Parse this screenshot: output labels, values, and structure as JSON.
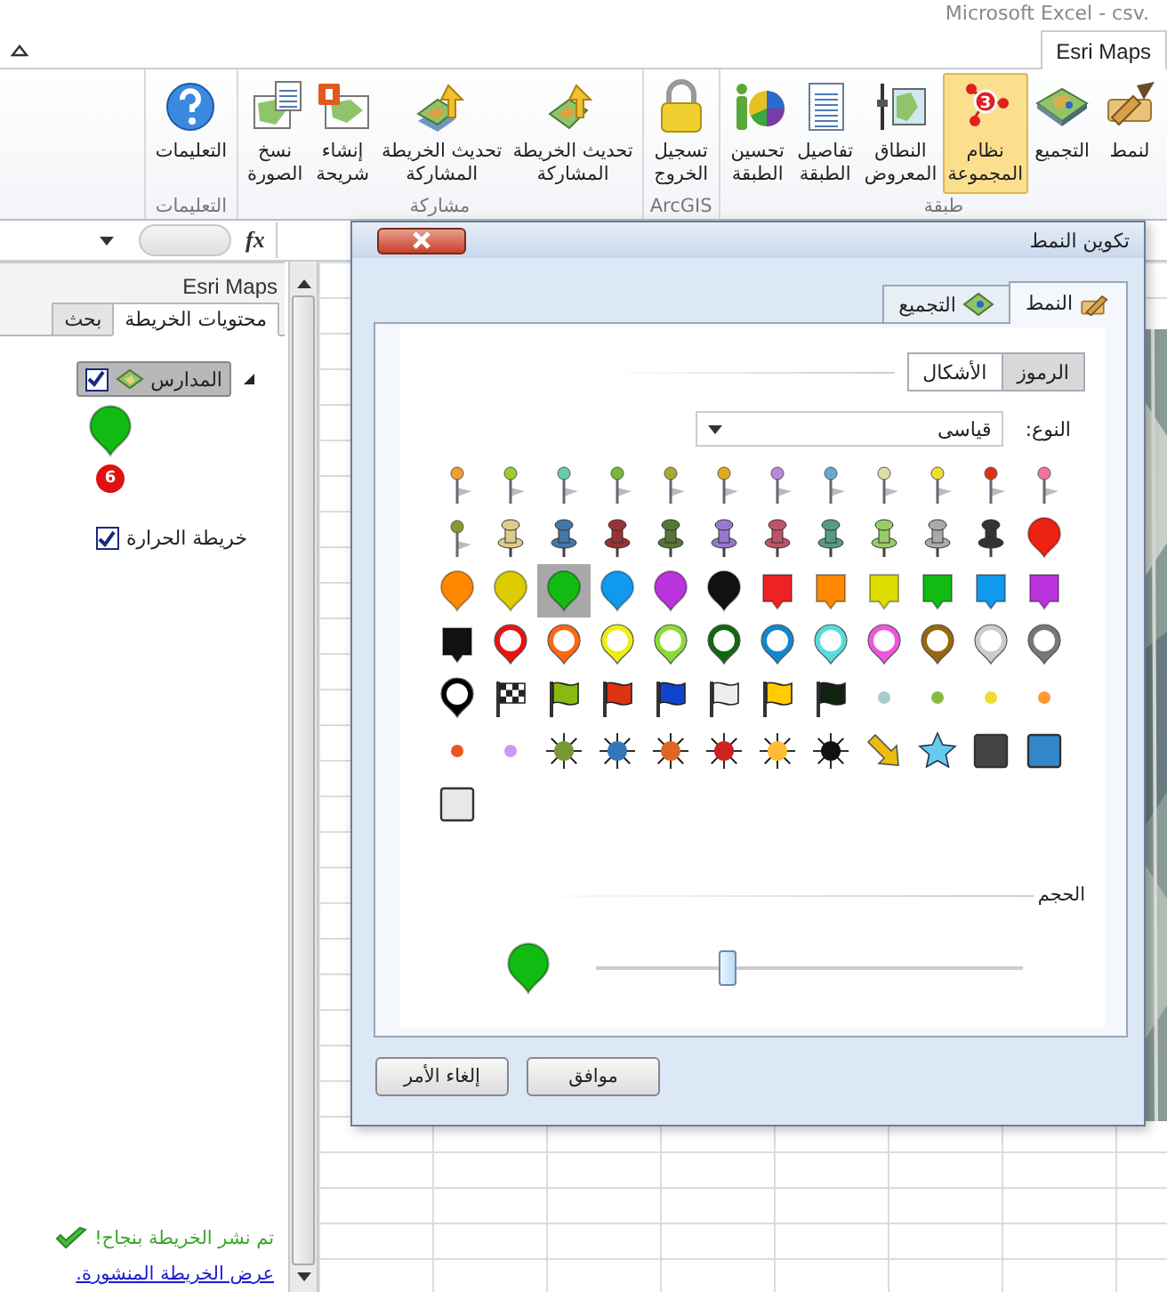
{
  "window": {
    "title": "Microsoft Excel - csv."
  },
  "ribbon_tabs": [
    {
      "label": "Esri Maps",
      "selected": true
    }
  ],
  "ribbon": {
    "groups": [
      {
        "label": "طبقة",
        "buttons": [
          {
            "lines": [
              "لنمط"
            ],
            "kind": "brush",
            "selected": false
          },
          {
            "lines": [
              "التجميع"
            ],
            "kind": "map",
            "selected": false
          },
          {
            "lines": [
              "نظام",
              "المجموعة"
            ],
            "kind": "cluster",
            "badge": "3",
            "selected": true
          },
          {
            "lines": [
              "النطاق",
              "المعروض"
            ],
            "kind": "extent",
            "selected": false
          },
          {
            "lines": [
              "تفاصيل",
              "الطبقة"
            ],
            "kind": "details",
            "selected": false
          },
          {
            "lines": [
              "تحسين",
              "الطبقة"
            ],
            "kind": "enhance",
            "selected": false
          }
        ]
      },
      {
        "label": "ArcGIS",
        "buttons": [
          {
            "lines": [
              "تسجيل",
              "الخروج"
            ],
            "kind": "signout",
            "selected": false
          }
        ]
      },
      {
        "label": "مشاركة",
        "buttons": [
          {
            "lines": [
              "تحديث الخريطة",
              "المشاركة"
            ],
            "kind": "share",
            "selected": false
          },
          {
            "lines": [
              "تحديث الخريطة",
              "المشاركة"
            ],
            "kind": "share-stack",
            "selected": false
          },
          {
            "lines": [
              "إنشاء",
              "شريحة"
            ],
            "kind": "slide",
            "selected": false
          },
          {
            "lines": [
              "نسخ",
              "الصورة"
            ],
            "kind": "copy",
            "selected": false
          }
        ]
      },
      {
        "label": "التعليمات",
        "buttons": [
          {
            "lines": [
              "التعليمات"
            ],
            "kind": "help",
            "selected": false
          }
        ]
      }
    ]
  },
  "formula_bar": {
    "function_label": "fx"
  },
  "pane": {
    "title": "Esri Maps",
    "tabs": [
      {
        "label": "محتويات الخريطة",
        "selected": true
      },
      {
        "label": "بحث",
        "selected": false
      }
    ],
    "layers": [
      {
        "kind": "cluster",
        "name": "المدارس",
        "checked": true,
        "expanded": true,
        "selected": true,
        "count": "6"
      },
      {
        "kind": "heatmap",
        "name": "خريطة الحرارة",
        "checked": true,
        "selected": false
      }
    ],
    "status": "تم نشر الخريطة بنجاح!",
    "link": "عرض الخريطة المنشورة."
  },
  "dialog": {
    "title": "تكوين النمط",
    "tabs": [
      {
        "label": "النمط",
        "kind": "style",
        "selected": true
      },
      {
        "label": "التجميع",
        "kind": "cluster",
        "selected": false
      }
    ],
    "modes": [
      {
        "label": "الرموز",
        "selected": true
      },
      {
        "label": "الأشكال",
        "selected": false
      }
    ],
    "type_label": "النوع:",
    "type_value": "قياسى",
    "symbols": [
      {
        "kind": "pin",
        "color": "#f0a030",
        "selected": false
      },
      {
        "kind": "pin",
        "color": "#9acd32",
        "selected": false
      },
      {
        "kind": "pin",
        "color": "#66ccaa",
        "selected": false
      },
      {
        "kind": "pin",
        "color": "#77bb33",
        "selected": false
      },
      {
        "kind": "pin",
        "color": "#aaaa33",
        "selected": false
      },
      {
        "kind": "pin",
        "color": "#ddaa22",
        "selected": false
      },
      {
        "kind": "pin",
        "color": "#bb88dd",
        "selected": false
      },
      {
        "kind": "pin",
        "color": "#66aacc",
        "selected": false
      },
      {
        "kind": "pin",
        "color": "#ddddaa",
        "selected": false
      },
      {
        "kind": "pin",
        "color": "#eedd33",
        "selected": false
      },
      {
        "kind": "pin",
        "color": "#dd3311",
        "selected": false
      },
      {
        "kind": "pin",
        "color": "#ee7799",
        "selected": false
      },
      {
        "kind": "pin",
        "color": "#889933",
        "selected": false
      },
      {
        "kind": "pushpin",
        "color": "#ddcc88",
        "selected": false
      },
      {
        "kind": "pushpin",
        "color": "#4477aa",
        "selected": false
      },
      {
        "kind": "pushpin",
        "color": "#993333",
        "selected": false
      },
      {
        "kind": "pushpin",
        "color": "#557733",
        "selected": false
      },
      {
        "kind": "pushpin",
        "color": "#9977cc",
        "selected": false
      },
      {
        "kind": "pushpin",
        "color": "#bb5566",
        "selected": false
      },
      {
        "kind": "pushpin",
        "color": "#559988",
        "selected": false
      },
      {
        "kind": "pushpin",
        "color": "#99cc66",
        "selected": false
      },
      {
        "kind": "pushpin",
        "color": "#aaaaaa",
        "selected": false
      },
      {
        "kind": "pushpin",
        "color": "#333333",
        "selected": false
      },
      {
        "kind": "balloon",
        "color": "#ee2211",
        "selected": false
      },
      {
        "kind": "balloon",
        "color": "#ff8800",
        "selected": false
      },
      {
        "kind": "balloon",
        "color": "#ddcc00",
        "selected": false
      },
      {
        "kind": "balloon",
        "color": "#11bb11",
        "selected": true
      },
      {
        "kind": "balloon",
        "color": "#1199ee",
        "selected": false
      },
      {
        "kind": "balloon",
        "color": "#bb33dd",
        "selected": false
      },
      {
        "kind": "balloon",
        "color": "#111111",
        "selected": false
      },
      {
        "kind": "callout",
        "color": "#ee2222",
        "selected": false
      },
      {
        "kind": "callout",
        "color": "#ff8800",
        "selected": false
      },
      {
        "kind": "callout",
        "color": "#dddd00",
        "selected": false
      },
      {
        "kind": "callout",
        "color": "#11bb11",
        "selected": false
      },
      {
        "kind": "callout",
        "color": "#1199ee",
        "selected": false
      },
      {
        "kind": "callout",
        "color": "#bb33dd",
        "selected": false
      },
      {
        "kind": "callout",
        "color": "#111111",
        "selected": false
      },
      {
        "kind": "ring",
        "color": "#ee1111",
        "selected": false
      },
      {
        "kind": "ring",
        "color": "#ff6611",
        "selected": false
      },
      {
        "kind": "ring",
        "color": "#eeee11",
        "selected": false
      },
      {
        "kind": "ring",
        "color": "#88dd33",
        "selected": false
      },
      {
        "kind": "ring",
        "color": "#116611",
        "selected": false
      },
      {
        "kind": "ring",
        "color": "#1188cc",
        "selected": false
      },
      {
        "kind": "ring",
        "color": "#55dddd",
        "selected": false
      },
      {
        "kind": "ring",
        "color": "#ee55dd",
        "selected": false
      },
      {
        "kind": "ring",
        "color": "#996611",
        "selected": false
      },
      {
        "kind": "ring",
        "color": "#cccccc",
        "selected": false
      },
      {
        "kind": "ring",
        "color": "#777777",
        "selected": false
      },
      {
        "kind": "ring",
        "color": "#000000",
        "selected": false
      },
      {
        "kind": "checkered-flag",
        "selected": false
      },
      {
        "kind": "flag",
        "color": "#88bb11",
        "selected": false
      },
      {
        "kind": "flag",
        "color": "#dd3311",
        "selected": false
      },
      {
        "kind": "flag",
        "color": "#1144cc",
        "selected": false
      },
      {
        "kind": "flag",
        "color": "#eeeeee",
        "selected": false
      },
      {
        "kind": "flag",
        "color": "#ffcc00",
        "selected": false
      },
      {
        "kind": "flag",
        "color": "#112211",
        "selected": false
      },
      {
        "kind": "dot",
        "color": "#aacccc",
        "selected": false
      },
      {
        "kind": "dot",
        "color": "#88bb44",
        "selected": false
      },
      {
        "kind": "dot",
        "color": "#eedd33",
        "selected": false
      },
      {
        "kind": "dot",
        "color": "#ff9933",
        "selected": false
      },
      {
        "kind": "dot",
        "color": "#ee5522",
        "selected": false
      },
      {
        "kind": "dot",
        "color": "#cc99ee",
        "selected": false
      },
      {
        "kind": "sun",
        "color": "#779933",
        "selected": false
      },
      {
        "kind": "sun",
        "color": "#3377bb",
        "selected": false
      },
      {
        "kind": "sun",
        "color": "#dd6622",
        "selected": false
      },
      {
        "kind": "sun",
        "color": "#cc2222",
        "selected": false
      },
      {
        "kind": "sun",
        "color": "#ffbb33",
        "selected": false
      },
      {
        "kind": "sun",
        "color": "#111111",
        "selected": false
      },
      {
        "kind": "arrow",
        "color": "#eebb11",
        "selected": false
      },
      {
        "kind": "star",
        "color": "#66ccee",
        "selected": false
      },
      {
        "kind": "square",
        "color": "#444444",
        "selected": false
      },
      {
        "kind": "square",
        "color": "#3388cc",
        "selected": false
      },
      {
        "kind": "square",
        "color": "#e8e8e8",
        "selected": false
      }
    ],
    "size_label": "الحجم",
    "size": {
      "level": 0.31
    },
    "buttons": [
      {
        "label": "موافق"
      },
      {
        "label": "إلغاء الأمر"
      }
    ]
  }
}
